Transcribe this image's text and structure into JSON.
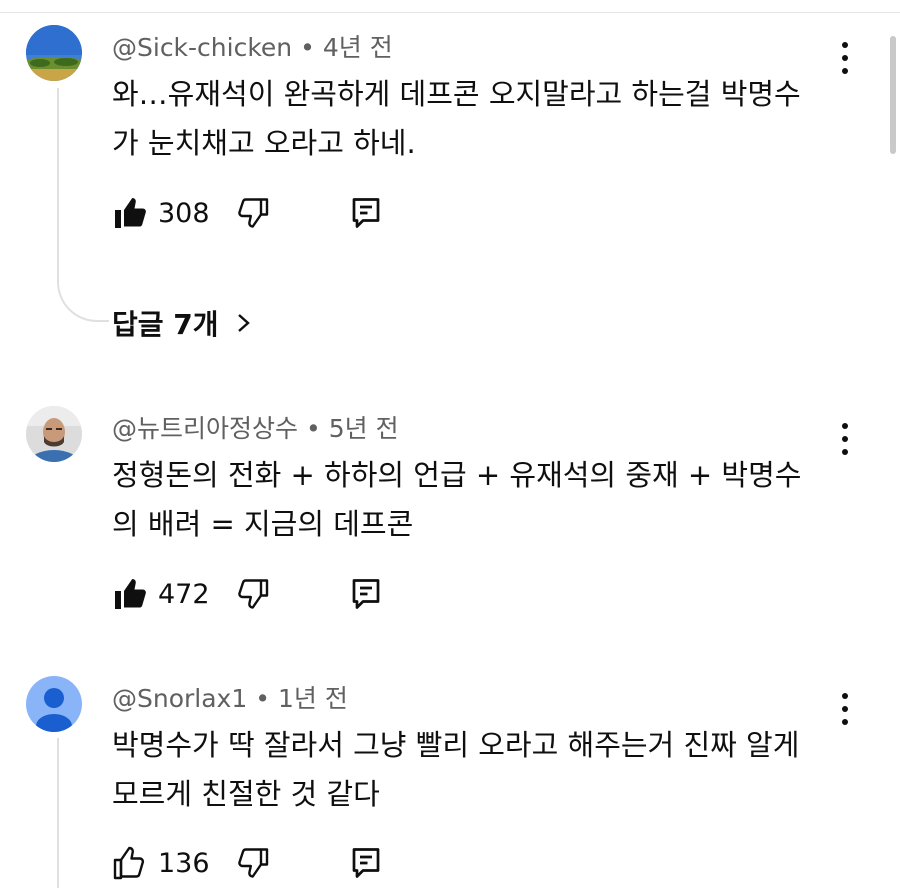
{
  "comments": [
    {
      "handle": "@Sick-chicken",
      "time": "4년 전",
      "text_line1": "와…유재석이 완곡하게 데프콘 오지말라고 하는걸 박명수",
      "text_line2": "가 눈치채고 오라고 하네.",
      "likes": "308",
      "replies_label": "답글 7개",
      "liked": true
    },
    {
      "handle": "@뉴트리아정상수",
      "time": "5년 전",
      "text_line1": "정형돈의 전화 + 하하의 언급 + 유재석의 중재 + 박명수",
      "text_line2": "의 배려 = 지금의 데프콘",
      "likes": "472",
      "liked": true
    },
    {
      "handle": "@Snorlax1",
      "time": "1년 전",
      "text_line1": "박명수가 딱 잘라서 그냥 빨리 오라고 해주는거 진짜 알게",
      "text_line2": "모르게 친절한 것 같다",
      "likes": "136",
      "liked": false
    }
  ],
  "separator": "•",
  "icons": {
    "like_filled": "thumbs-up-filled-icon",
    "like_outline": "thumbs-up-outline-icon",
    "dislike": "thumbs-down-icon",
    "reply": "reply-comment-icon",
    "more": "more-vert-icon",
    "chevron": "chevron-right-icon"
  },
  "colors": {
    "text": "#0f0f0f",
    "meta": "#606060",
    "divider": "#e0e0e0",
    "default_avatar": "#8ab4f8"
  }
}
